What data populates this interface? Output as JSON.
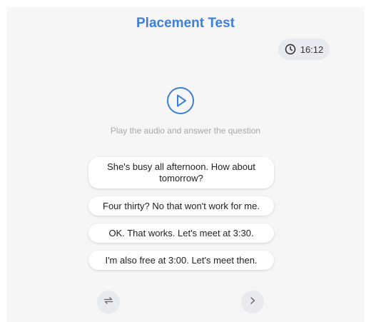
{
  "header": {
    "title": "Placement Test"
  },
  "timer": {
    "icon": "clock-icon",
    "value": "16:12"
  },
  "player": {
    "icon": "play-icon",
    "instruction": "Play the audio and answer the question"
  },
  "options": [
    "She's busy all afternoon. How about tomorrow?",
    "Four thirty? No that won't work for me.",
    "OK. That works. Let's meet at 3:30.",
    "I'm also free at 3:00. Let's meet then."
  ],
  "footer": {
    "repeat_icon": "repeat-icon",
    "next_icon": "chevron-right-icon"
  },
  "colors": {
    "accent": "#3f7fd6",
    "background": "#f6f6f7",
    "muted_text": "#a8a8ad"
  }
}
